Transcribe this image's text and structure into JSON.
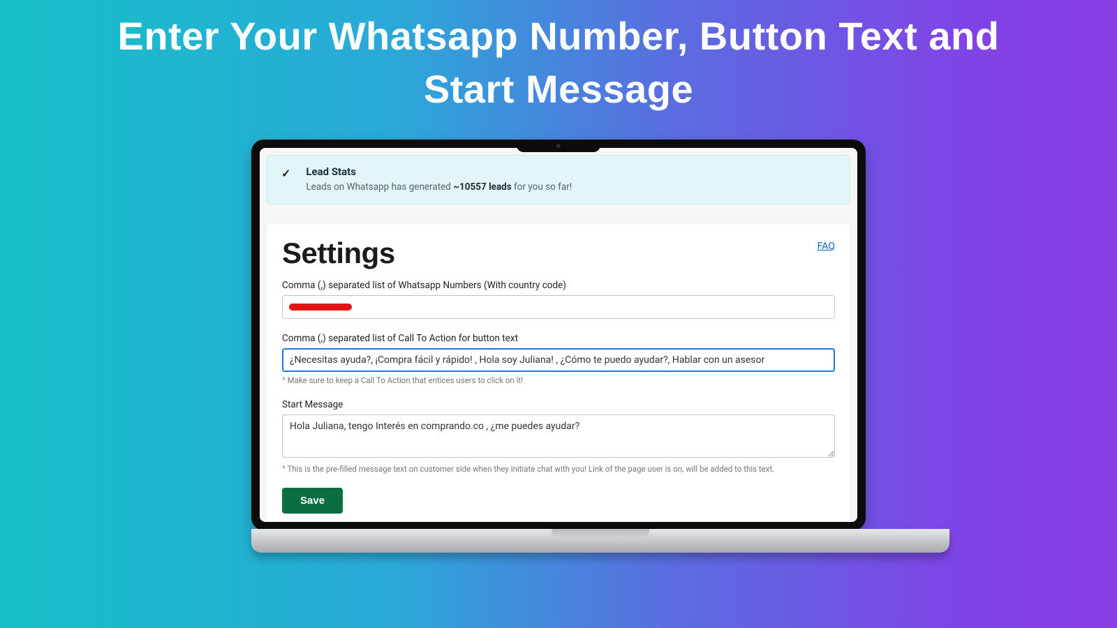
{
  "hero": {
    "title_line1": "Enter Your Whatsapp Number, Button Text and",
    "title_line2": "Start Message"
  },
  "banner": {
    "title": "Lead Stats",
    "prefix": "Leads on Whatsapp has generated ",
    "count": "~10557 leads",
    "suffix": " for you so far!"
  },
  "settings": {
    "heading": "Settings",
    "faq": "FAQ",
    "numbers_label": "Comma (,) separated list of Whatsapp Numbers (With country code)",
    "numbers_value": "",
    "cta_label": "Comma (,) separated list of Call To Action for button text",
    "cta_value": "¿Necesitas ayuda?, ¡Compra fácil y rápido! , Hola soy Juliana! , ¿Cómo te puedo ayudar?, Hablar con un asesor",
    "cta_helper": "^ Make sure to keep a Call To Action that entices users to click on it!",
    "start_label": "Start Message",
    "start_value": "Hola Juliana, tengo Interés en comprando.co , ¿me puedes ayudar?",
    "start_helper": "^ This is the pre-filled message text on customer side when they initiate chat with you! Link of the page user is on, will be added to this text.",
    "save": "Save"
  }
}
